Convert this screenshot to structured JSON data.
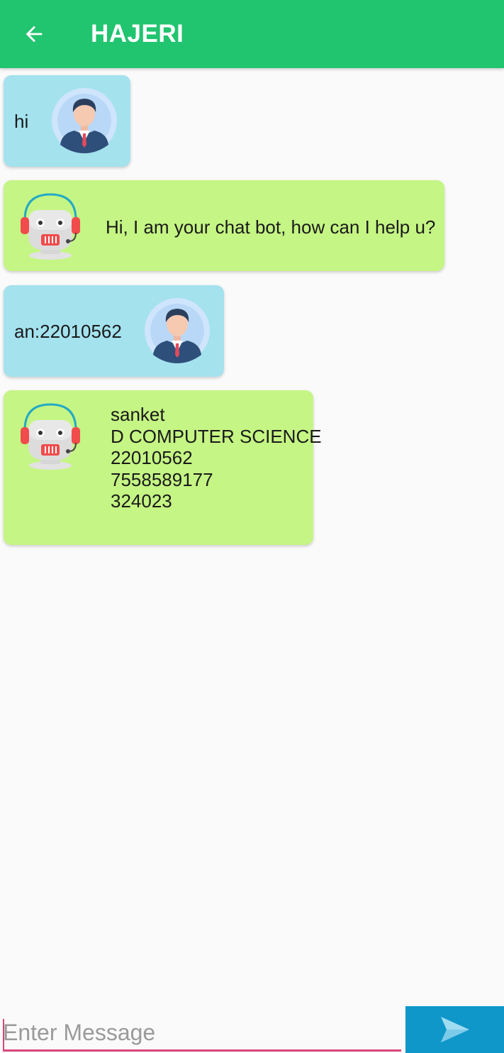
{
  "toolbar": {
    "title": "HAJERI",
    "back_icon": "arrow-left-icon",
    "color": "#21c46f"
  },
  "messages": [
    {
      "sender": "user",
      "text": "hi",
      "avatar": "businessman-avatar-icon"
    },
    {
      "sender": "bot",
      "text": "Hi, I am your chat bot,  how can I help u?",
      "avatar": "robot-headset-avatar-icon"
    },
    {
      "sender": "user",
      "text": "an:22010562",
      "avatar": "businessman-avatar-icon"
    },
    {
      "sender": "bot",
      "lines": [
        "sanket",
        "D COMPUTER SCIENCE",
        "22010562",
        "7558589177",
        "324023"
      ],
      "avatar": "robot-headset-avatar-icon"
    }
  ],
  "composer": {
    "placeholder": "Enter Message",
    "send_icon": "send-icon"
  },
  "colors": {
    "user_bubble": "#a4e2ee",
    "bot_bubble": "#c5f584",
    "send_button": "#0f97c9",
    "input_underline": "#d9477a"
  }
}
